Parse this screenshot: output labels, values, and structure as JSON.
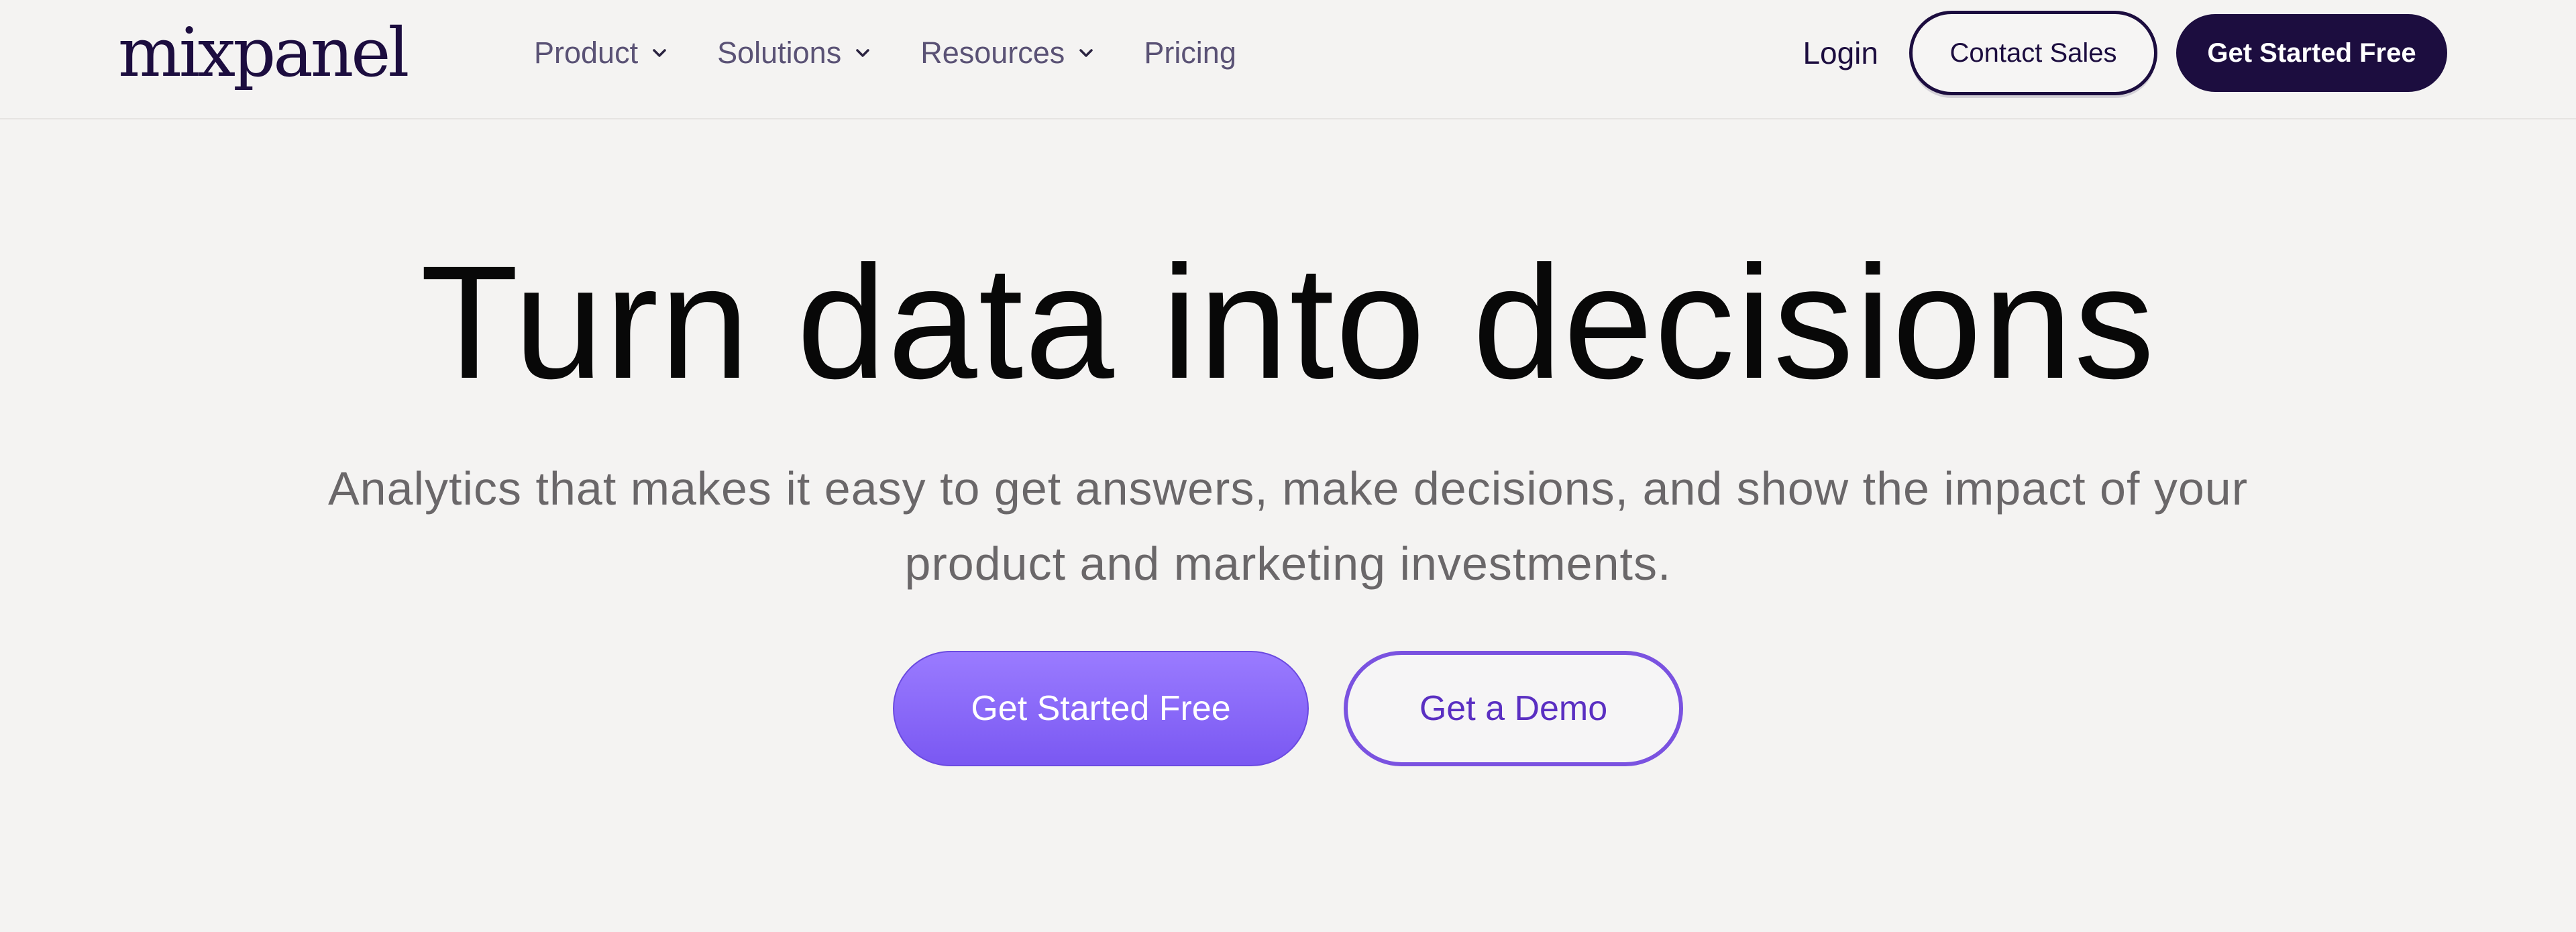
{
  "header": {
    "logo_text": "mixpanel",
    "nav": [
      {
        "label": "Product",
        "has_dropdown": true,
        "icon": "chevron-down-icon"
      },
      {
        "label": "Solutions",
        "has_dropdown": true,
        "icon": "chevron-down-icon"
      },
      {
        "label": "Resources",
        "has_dropdown": true,
        "icon": "chevron-down-icon"
      },
      {
        "label": "Pricing",
        "has_dropdown": false
      }
    ],
    "login_label": "Login",
    "contact_sales_label": "Contact Sales",
    "get_started_label": "Get Started Free"
  },
  "hero": {
    "title": "Turn data into decisions",
    "subtitle": "Analytics that makes it easy to get answers, make decisions, and show the impact of your product and marketing investments.",
    "primary_cta": "Get Started Free",
    "secondary_cta": "Get a Demo"
  },
  "colors": {
    "background": "#f4f3f2",
    "brand_dark": "#1c0d3f",
    "accent_purple": "#7a58f2",
    "demo_text": "#5a2fc2"
  }
}
